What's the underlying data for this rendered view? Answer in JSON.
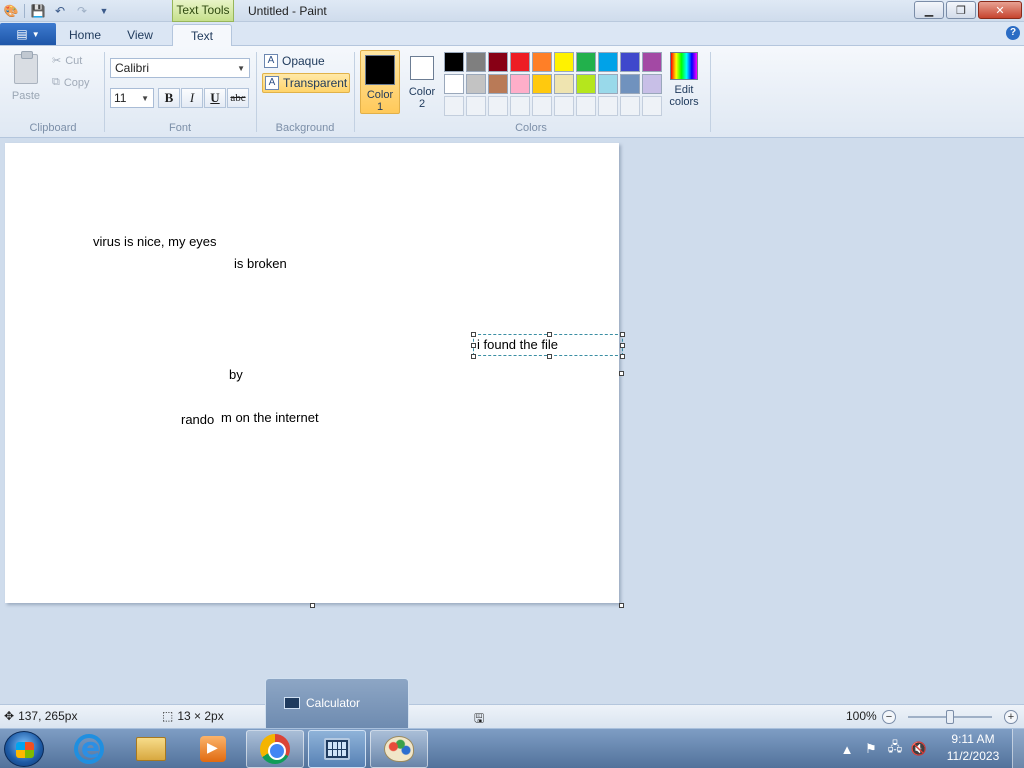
{
  "window": {
    "title": "Untitled - Paint",
    "contextual_tab": "Text Tools"
  },
  "window_buttons": {
    "minimize_icon": "minimize-icon",
    "maximize_icon": "restore-icon",
    "close_icon": "close-icon"
  },
  "tabs": {
    "home": "Home",
    "view": "View",
    "text": "Text"
  },
  "clipboard": {
    "paste": "Paste",
    "cut": "Cut",
    "copy": "Copy",
    "label": "Clipboard"
  },
  "font": {
    "family": "Calibri",
    "size": "11",
    "bold": "B",
    "italic": "I",
    "underline": "U",
    "strikethrough": "abc",
    "label": "Font"
  },
  "background": {
    "opaque": "Opaque",
    "transparent": "Transparent",
    "label": "Background",
    "selected": "Transparent"
  },
  "colors": {
    "color1_label_line1": "Color",
    "color1_label_line2": "1",
    "color2_label_line1": "Color",
    "color2_label_line2": "2",
    "color1": "#000000",
    "color2": "#ffffff",
    "edit_line1": "Edit",
    "edit_line2": "colors",
    "label": "Colors",
    "palette_row1": [
      "#000000",
      "#7f7f7f",
      "#880015",
      "#ed1c24",
      "#ff7f27",
      "#fff200",
      "#22b14c",
      "#00a2e8",
      "#3f48cc",
      "#a349a4"
    ],
    "palette_row2": [
      "#ffffff",
      "#c3c3c3",
      "#b97a57",
      "#ffaec9",
      "#ffc90e",
      "#efe4b0",
      "#b5e61d",
      "#99d9ea",
      "#7092be",
      "#c8bfe7"
    ]
  },
  "canvas_texts": {
    "line1": "virus is nice, my eyes",
    "line2": "is broken",
    "line3": "by",
    "line4a": "rando",
    "line4b": "m on the internet",
    "editing": "i found the file"
  },
  "status": {
    "cursor": "137, 265px",
    "selection": "13 × 2px",
    "zoom": "100%"
  },
  "taskbar": {
    "preview_title": "Calculator",
    "time": "9:11 AM",
    "date": "11/2/2023"
  }
}
